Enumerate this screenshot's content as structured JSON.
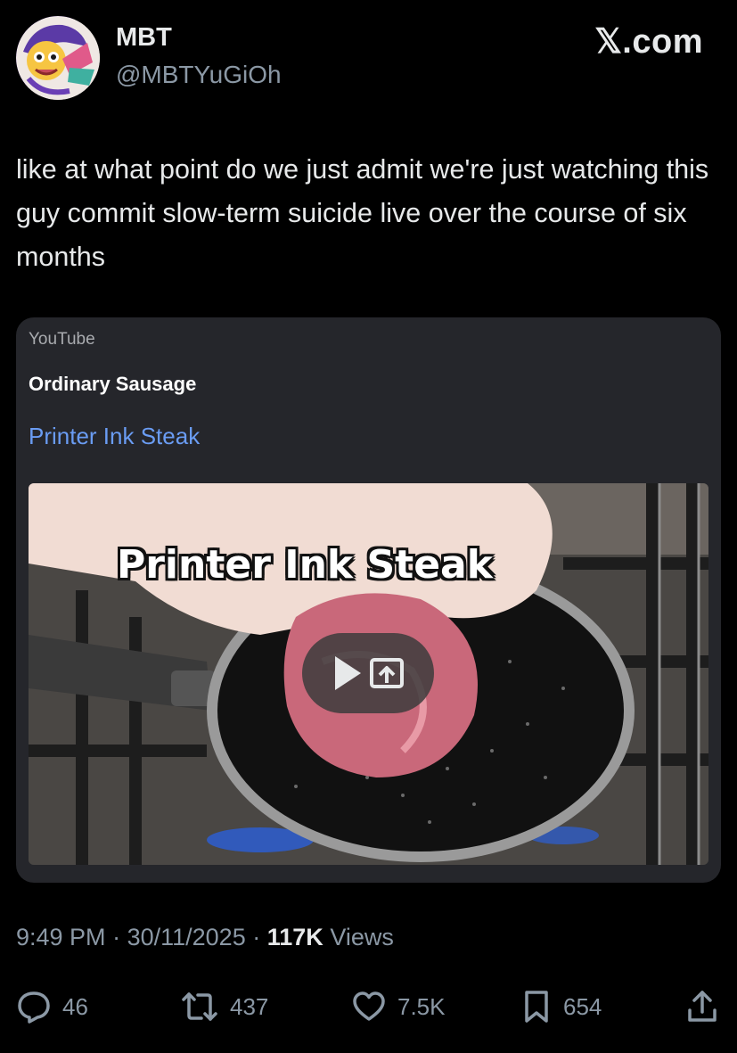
{
  "author": {
    "display_name": "MBT",
    "handle": "@MBTYuGiOh",
    "avatar_icon": "avatar-image"
  },
  "brand": {
    "logo_text": "𝕏.com"
  },
  "tweet": {
    "text": "like at what point do we just admit we're just watching this guy commit slow-term suicide live over the course of six months"
  },
  "card": {
    "provider": "YouTube",
    "author": "Ordinary Sausage",
    "title": "Printer Ink Steak",
    "video_caption": "Printer Ink Steak",
    "link_color": "#6a9cf3"
  },
  "meta": {
    "time": "9:49 PM",
    "date": "30/11/2025",
    "views_count": "117K",
    "views_label": "Views"
  },
  "actions": {
    "replies": "46",
    "reposts": "437",
    "likes": "7.5K",
    "bookmarks": "654"
  },
  "colors": {
    "background": "#000000",
    "text": "#e7e9ea",
    "secondary": "#8b98a5",
    "card_bg": "#25262b"
  }
}
